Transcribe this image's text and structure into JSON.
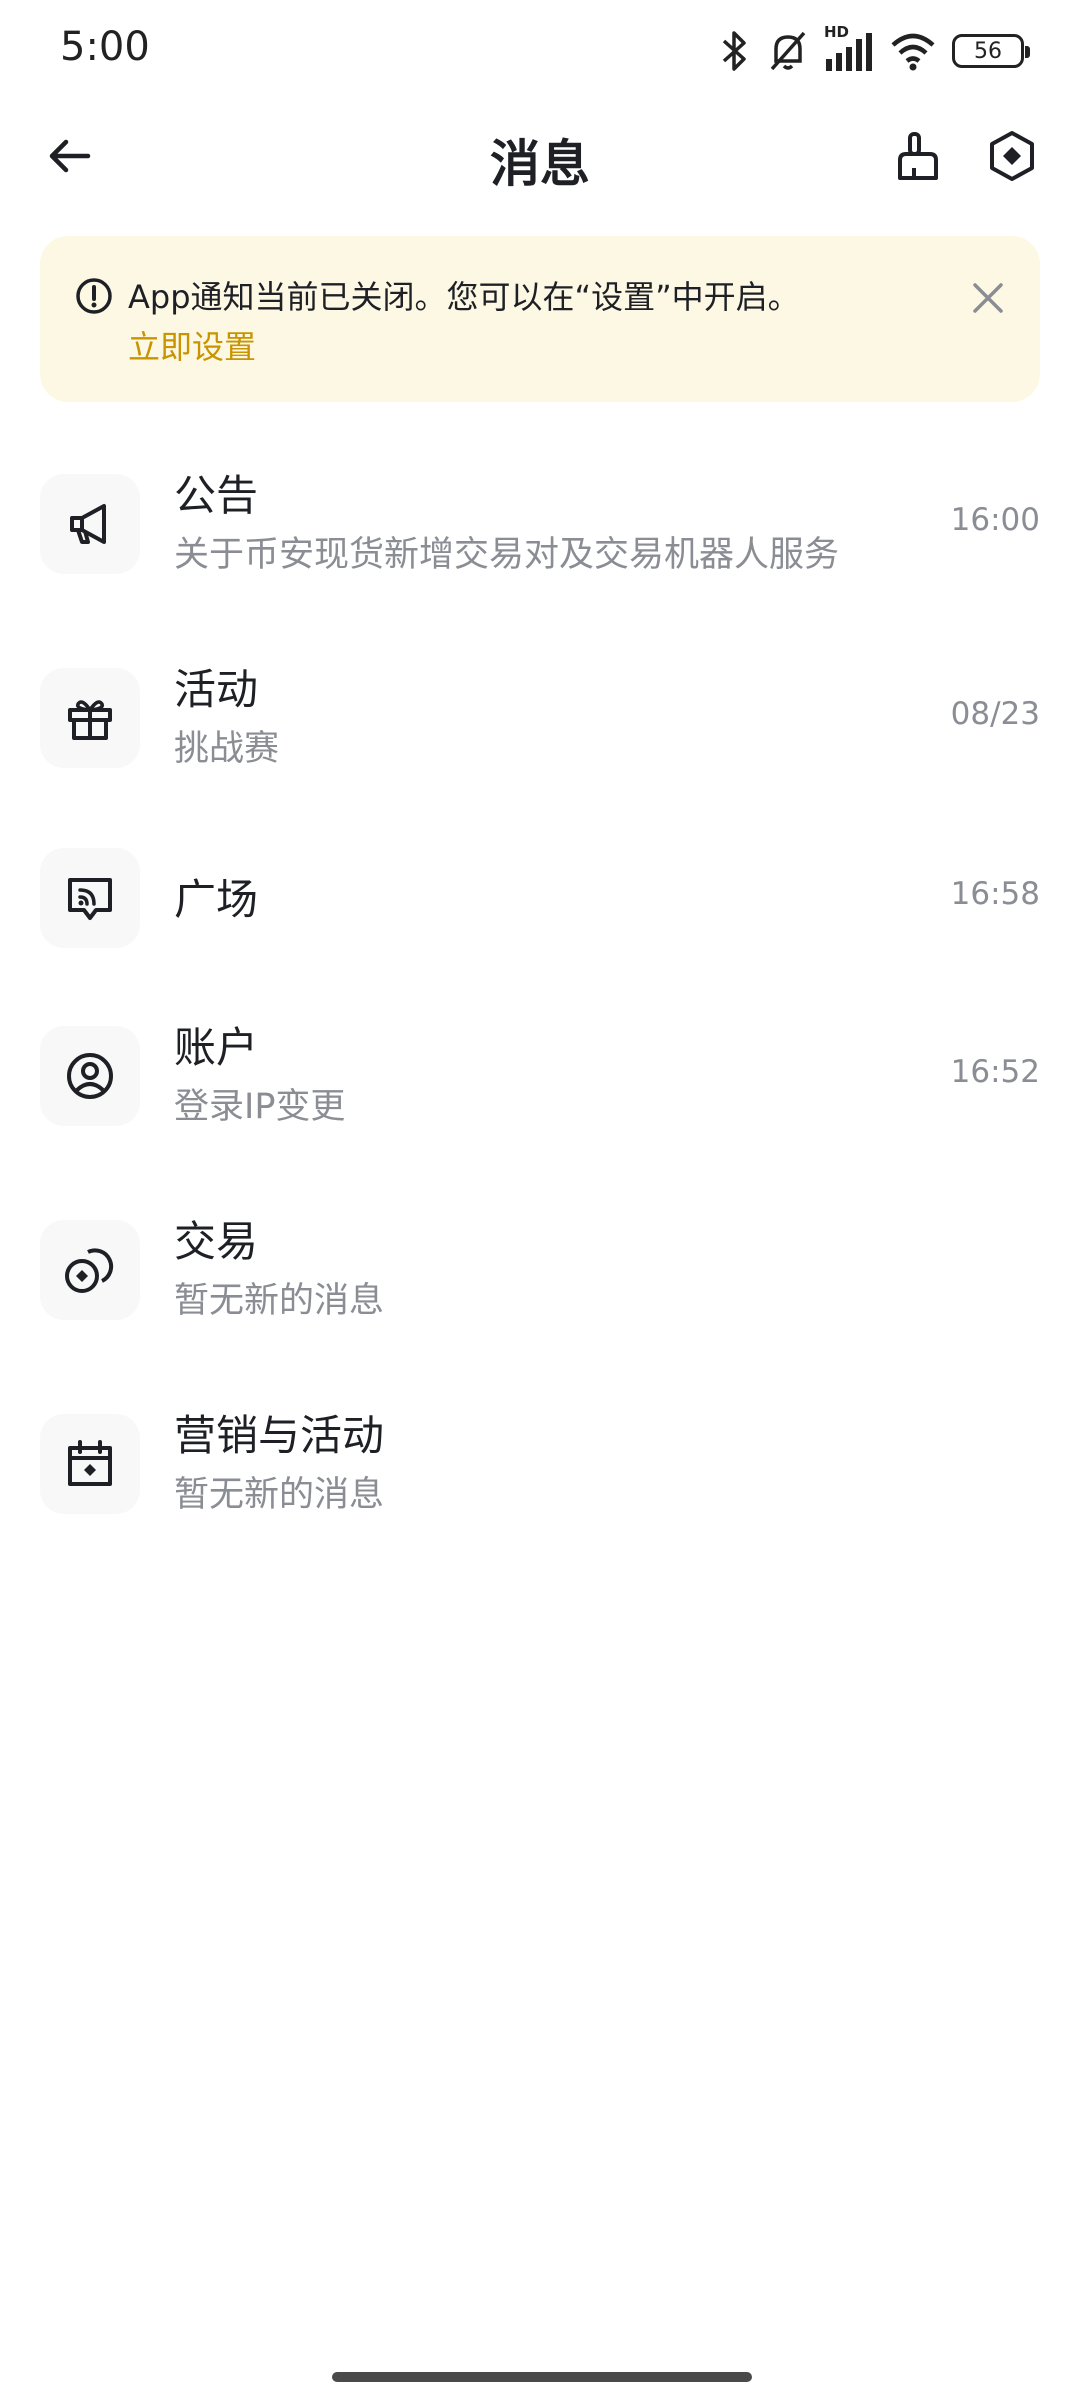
{
  "status_bar": {
    "time": "5:00",
    "network_badge": "HD",
    "battery_level": "56",
    "icons": [
      "bluetooth-icon",
      "bell-off-icon",
      "signal-icon",
      "wifi-icon",
      "battery-icon"
    ]
  },
  "header": {
    "title": "消息",
    "icons": [
      "back-arrow-icon",
      "broom-icon",
      "settings-hexagon-icon"
    ]
  },
  "banner": {
    "text": "App通知当前已关闭。您可以在“设置”中开启。",
    "link": "立即设置",
    "icons": [
      "info-icon",
      "close-icon"
    ]
  },
  "messages": [
    {
      "title": "公告",
      "subtitle": "关于币安现货新增交易对及交易机器人服务",
      "time": "16:00",
      "icon": "megaphone-icon"
    },
    {
      "title": "活动",
      "subtitle": "挑战赛",
      "time": "08/23",
      "icon": "gift-icon"
    },
    {
      "title": "广场",
      "subtitle": "",
      "time": "16:58",
      "icon": "square-broadcast-icon"
    },
    {
      "title": "账户",
      "subtitle": "登录IP变更",
      "time": "16:52",
      "icon": "user-circle-icon"
    },
    {
      "title": "交易",
      "subtitle": "暂无新的消息",
      "time": "",
      "icon": "coins-icon"
    },
    {
      "title": "营销与活动",
      "subtitle": "暂无新的消息",
      "time": "",
      "icon": "calendar-icon"
    }
  ],
  "colors": {
    "banner_bg": "#fdf8e4",
    "link": "#c99400",
    "primary_text": "#1e2026",
    "secondary_text": "#8a8d94"
  }
}
